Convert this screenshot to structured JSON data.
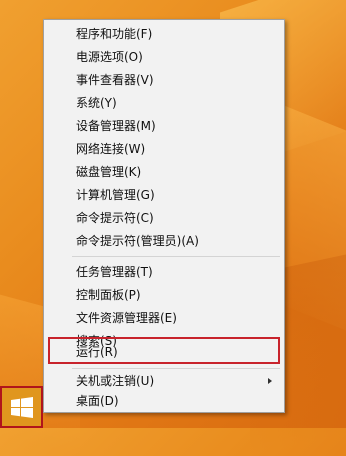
{
  "context_menu": {
    "items": [
      {
        "label": "程序和功能(F)"
      },
      {
        "label": "电源选项(O)"
      },
      {
        "label": "事件查看器(V)"
      },
      {
        "label": "系统(Y)"
      },
      {
        "label": "设备管理器(M)"
      },
      {
        "label": "网络连接(W)"
      },
      {
        "label": "磁盘管理(K)"
      },
      {
        "label": "计算机管理(G)"
      },
      {
        "label": "命令提示符(C)"
      },
      {
        "label": "命令提示符(管理员)(A)"
      },
      {
        "label": "任务管理器(T)"
      },
      {
        "label": "控制面板(P)"
      },
      {
        "label": "文件资源管理器(E)"
      },
      {
        "label": "搜索(S)"
      },
      {
        "label": "运行(R)",
        "highlighted": true
      },
      {
        "label": "关机或注销(U)",
        "has_submenu": true
      },
      {
        "label": "桌面(D)"
      }
    ]
  },
  "taskbar": {
    "start_button_icon": "windows-logo-icon"
  },
  "colors": {
    "desktop_background": "#e98c1e",
    "menu_background": "#f2f2f2",
    "highlight_border": "#c8232c",
    "windows_logo": "#ffffff"
  }
}
